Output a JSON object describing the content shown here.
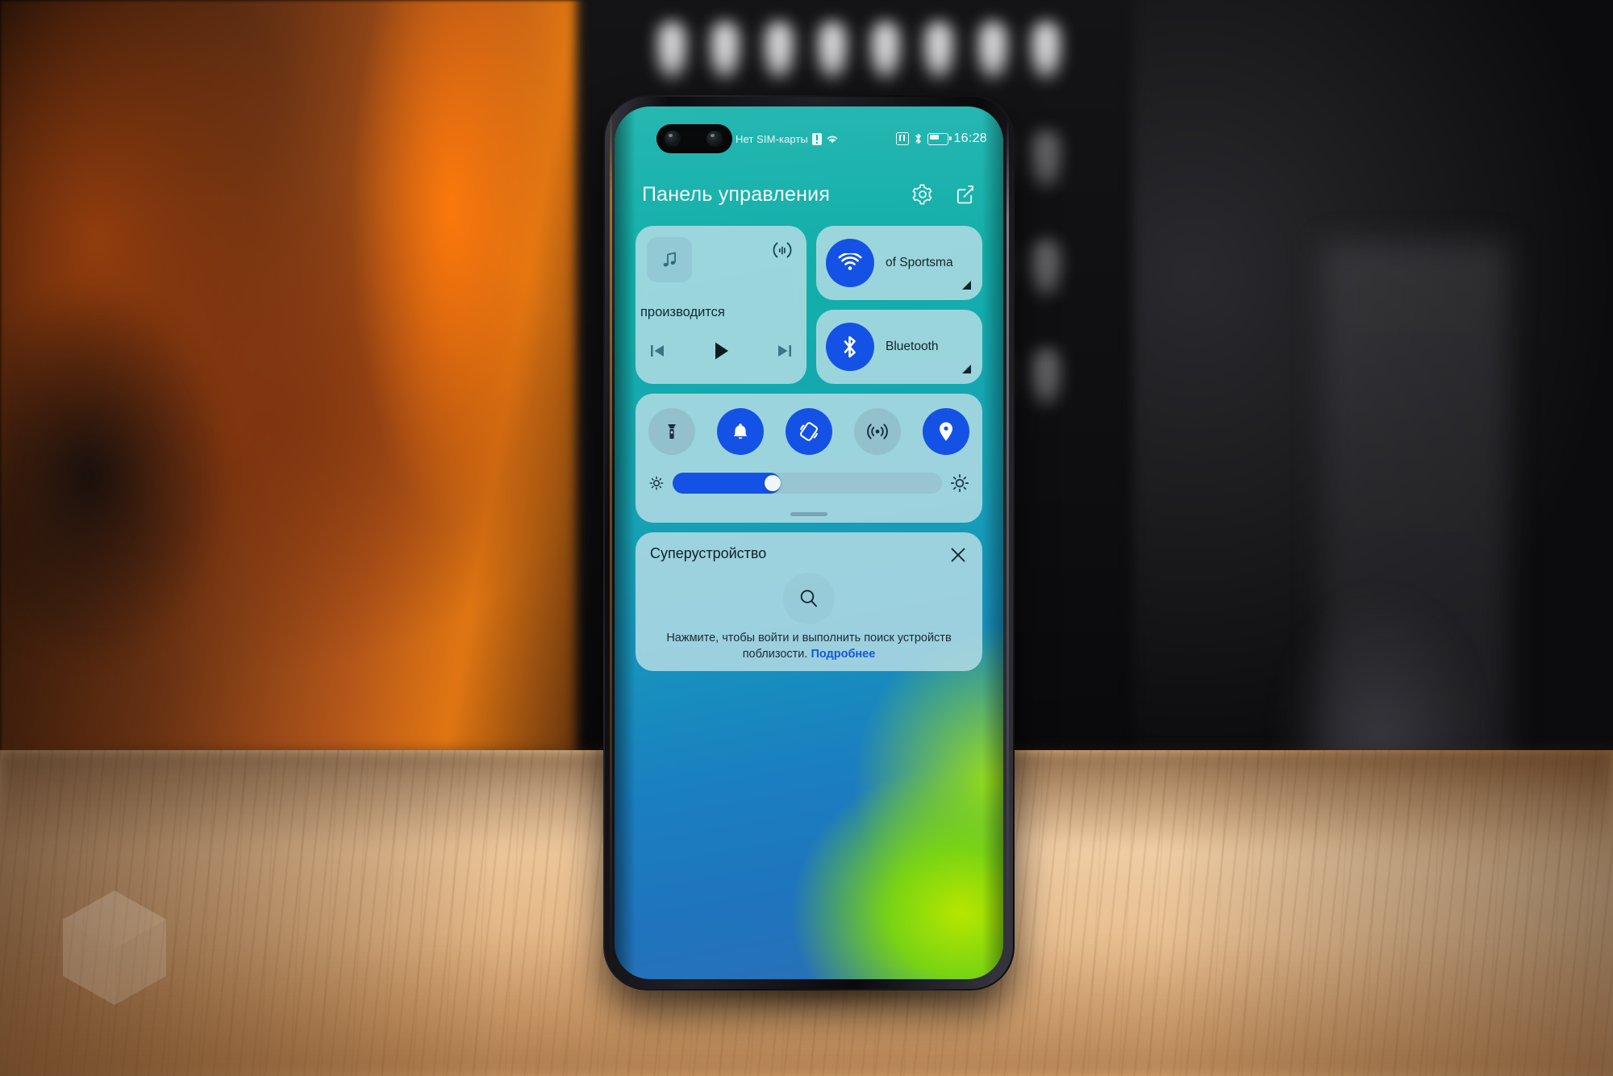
{
  "status_bar": {
    "carrier_text": "Нет SIM-карты",
    "time": "16:28",
    "icons": [
      "sim-alert-icon",
      "wifi-icon",
      "nfc-icon",
      "bluetooth-icon",
      "battery-icon"
    ],
    "battery_percent": 55
  },
  "header": {
    "title": "Панель управления",
    "settings_label": "gear-icon",
    "edit_label": "edit-icon"
  },
  "media": {
    "title": "производится",
    "album_art": "music-note-icon",
    "cast_label": "audio-output-icon",
    "prev_label": "skip-previous-icon",
    "play_label": "play-icon",
    "next_label": "skip-next-icon"
  },
  "network": {
    "wifi": {
      "label": "of Sportsma",
      "icon": "wifi-icon",
      "state": "on"
    },
    "bluetooth": {
      "label": "Bluetooth",
      "icon": "bluetooth-icon",
      "state": "on"
    }
  },
  "toggles": [
    {
      "name": "flashlight",
      "icon": "flashlight-icon",
      "state": "off"
    },
    {
      "name": "ringer",
      "icon": "bell-icon",
      "state": "on"
    },
    {
      "name": "auto-rotate",
      "icon": "rotate-icon",
      "state": "on"
    },
    {
      "name": "hotspot",
      "icon": "hotspot-icon",
      "state": "off"
    },
    {
      "name": "location",
      "icon": "location-pin-icon",
      "state": "on"
    }
  ],
  "brightness": {
    "value_percent": 40,
    "low_icon": "brightness-low-icon",
    "high_icon": "brightness-high-icon"
  },
  "superdevice": {
    "title": "Суперустройство",
    "close_label": "close-icon",
    "search_label": "search-icon",
    "description_line1": "Нажмите, чтобы войти и выполнить поиск",
    "description_line2": "устройств поблизости.",
    "link_text": "Подробнее"
  },
  "colors": {
    "accent_blue": "#1452e6",
    "card_bg": "rgba(186,222,231,0.82)",
    "screen_teal": "#16b2ab",
    "screen_green": "#b7e600",
    "link_blue": "#1558d6"
  },
  "watermark": {
    "label": "hexagon-logo"
  }
}
